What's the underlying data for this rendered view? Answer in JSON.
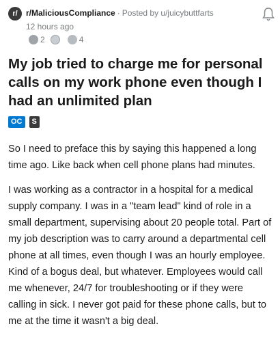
{
  "post": {
    "subreddit": "r/MaliciousCompliance",
    "subreddit_icon": "r/",
    "separator": "·",
    "posted_by": "Posted by u/juicybuttfarts",
    "time": "12 hours ago",
    "awards": [
      {
        "icon": "helpful-award-icon",
        "count": "2",
        "color": "#9ea4a8"
      },
      {
        "icon": "wholesome-award-icon",
        "count": "",
        "color": "#c9ced2"
      },
      {
        "icon": "silver-award-icon",
        "count": "4",
        "color": "#b7bcc0"
      }
    ],
    "title": "My job tried to charge me for personal calls on my work phone even though I had an unlimited plan",
    "flairs": [
      "OC",
      "S"
    ],
    "paragraphs": [
      "So I need to preface this by saying this happened a long time ago. Like back when cell phone plans had minutes.",
      "I was working as a contractor in a hospital for a medical supply company. I was in a \"team lead\" kind of role in a small department, supervising about 20 people total. Part of my job description was to carry around a departmental cell phone at all times, even though I was an hourly employee. Kind of a bogus deal, but whatever. Employees would call me whenever, 24/7 for troubleshooting or if they were calling in sick. I never got paid for these phone calls, but to me at the time it wasn't a big deal."
    ]
  }
}
